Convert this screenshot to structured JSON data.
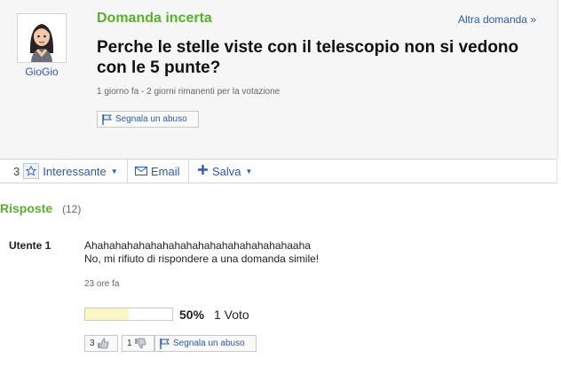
{
  "question": {
    "user_name": "GioGio",
    "status": "Domanda incerta",
    "next_link": "Altra domanda »",
    "title": "Perche le stelle viste con il telescopio non si vedono con le 5 punte?",
    "meta": "1 giorno fa - 2 giorni rimanenti per la votazione",
    "report_label": "Segnala un abuso"
  },
  "actions": {
    "star_count": "3",
    "interesting_label": "Interessante",
    "email_label": "Email",
    "save_label": "Salva"
  },
  "answers": {
    "title": "Risposte",
    "count": "(12)",
    "items": [
      {
        "user": "Utente 1",
        "line1": "Ahahahahahahahahahahahahahahahahahaaha",
        "line2": "No, mi rifiuto di rispondere a una domanda simile!",
        "time": "23 ore fa",
        "vote_fraction": 0.5,
        "vote_pct": "50%",
        "vote_count": "1 Voto",
        "thumbs_up": "3",
        "thumbs_down": "1",
        "report_label": "Segnala un abuso"
      }
    ]
  },
  "colors": {
    "accent_green": "#56b22a",
    "link_blue": "#2d5aa8",
    "vote_fill": "#fbf7c8"
  }
}
